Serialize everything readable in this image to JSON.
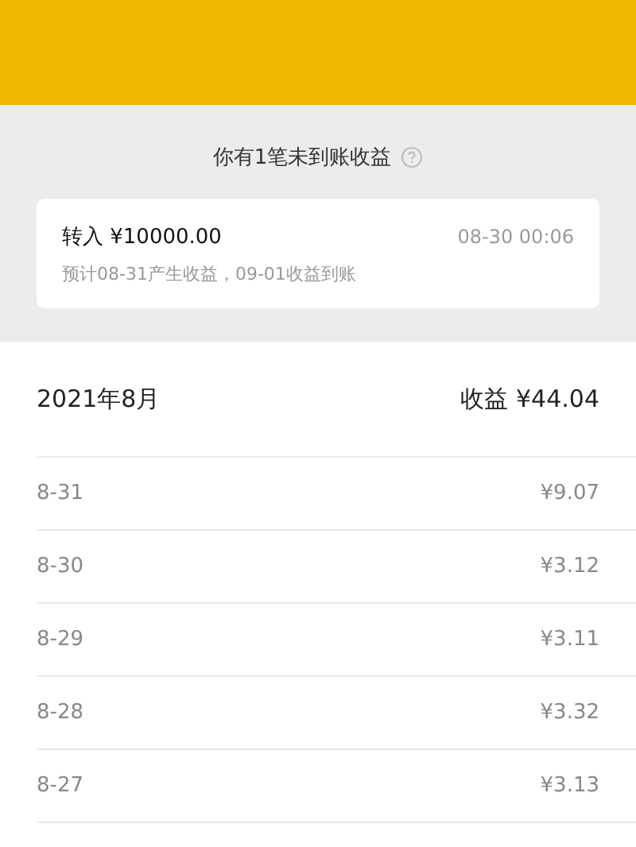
{
  "pending": {
    "title": "你有1笔未到账收益",
    "item": {
      "label": "转入 ¥10000.00",
      "time": "08-30 00:06",
      "note": "预计08-31产生收益，09-01收益到账"
    }
  },
  "month": {
    "label": "2021年8月",
    "total": "收益 ¥44.04"
  },
  "days": [
    {
      "date": "8-31",
      "amount": "¥9.07"
    },
    {
      "date": "8-30",
      "amount": "¥3.12"
    },
    {
      "date": "8-29",
      "amount": "¥3.11"
    },
    {
      "date": "8-28",
      "amount": "¥3.32"
    },
    {
      "date": "8-27",
      "amount": "¥3.13"
    }
  ]
}
